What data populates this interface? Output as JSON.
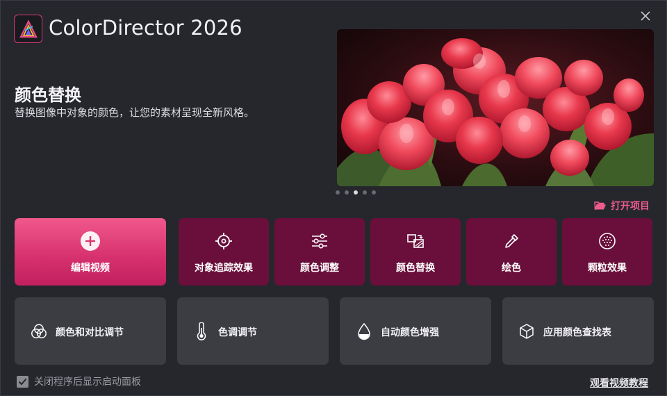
{
  "app": {
    "title": "ColorDirector 2026",
    "brand_color": "#d83a7a"
  },
  "feature": {
    "heading": "颜色替换",
    "description": "替换图像中对象的颜色，让您的素材呈现全新风格。"
  },
  "carousel": {
    "slide_count": 5,
    "active_index": 2
  },
  "open_project": {
    "label": "打开项目",
    "icon": "folder-open-icon"
  },
  "primary_tiles": [
    {
      "label": "编辑视频",
      "icon": "plus-circle-icon"
    },
    {
      "label": "对象追踪效果",
      "icon": "crosshair-icon"
    },
    {
      "label": "颜色调整",
      "icon": "sliders-icon"
    },
    {
      "label": "颜色替换",
      "icon": "color-swap-icon"
    },
    {
      "label": "绘色",
      "icon": "eyedropper-icon"
    },
    {
      "label": "颗粒效果",
      "icon": "grain-icon"
    }
  ],
  "secondary_tiles": [
    {
      "label": "颜色和对比调节",
      "icon": "color-circles-icon"
    },
    {
      "label": "色调调节",
      "icon": "thermometer-icon"
    },
    {
      "label": "自动颜色增强",
      "icon": "droplet-icon"
    },
    {
      "label": "应用颜色查找表",
      "icon": "cube-icon"
    }
  ],
  "footer": {
    "show_on_close_label": "关闭程序后显示启动面板",
    "show_on_close_checked": true,
    "tutorial_link": "观看视频教程"
  },
  "colors": {
    "accent": "#ef5c8c",
    "primary_tile_dark": "#6a0f3b",
    "secondary_tile": "#3c3d43"
  }
}
